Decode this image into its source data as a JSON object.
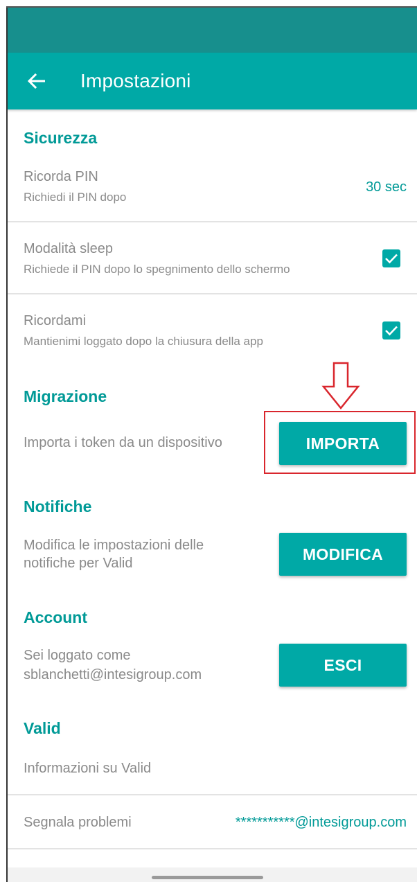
{
  "app_bar": {
    "title": "Impostazioni",
    "back_icon": "arrow-left-icon"
  },
  "sections": {
    "security": {
      "title": "Sicurezza",
      "remember_pin": {
        "title": "Ricorda PIN",
        "subtitle": "Richiedi il PIN dopo",
        "value": "30 sec"
      },
      "sleep_mode": {
        "title": "Modalità sleep",
        "subtitle": "Richiede il PIN dopo lo spegnimento dello schermo",
        "checked": true
      },
      "remember_me": {
        "title": "Ricordami",
        "subtitle": "Mantienimi loggato dopo la chiusura della app",
        "checked": true
      }
    },
    "migration": {
      "title": "Migrazione",
      "description": "Importa i token da un dispositivo",
      "button": "IMPORTA"
    },
    "notifications": {
      "title": "Notifiche",
      "description_line1": "Modifica le impostazioni delle",
      "description_line2": "notifiche per Valid",
      "button": "MODIFICA"
    },
    "account": {
      "title": "Account",
      "line1": "Sei loggato come",
      "email": "sblanchetti@intesigroup.com",
      "button": "ESCI"
    },
    "valid": {
      "title": "Valid",
      "info": "Informazioni su Valid",
      "report_label": "Segnala problemi",
      "report_email": "***********@intesigroup.com"
    }
  },
  "colors": {
    "status_bar": "#178f8d",
    "app_bar": "#00a9a6",
    "accent_text": "#019a97",
    "annotation": "#d9262d"
  }
}
